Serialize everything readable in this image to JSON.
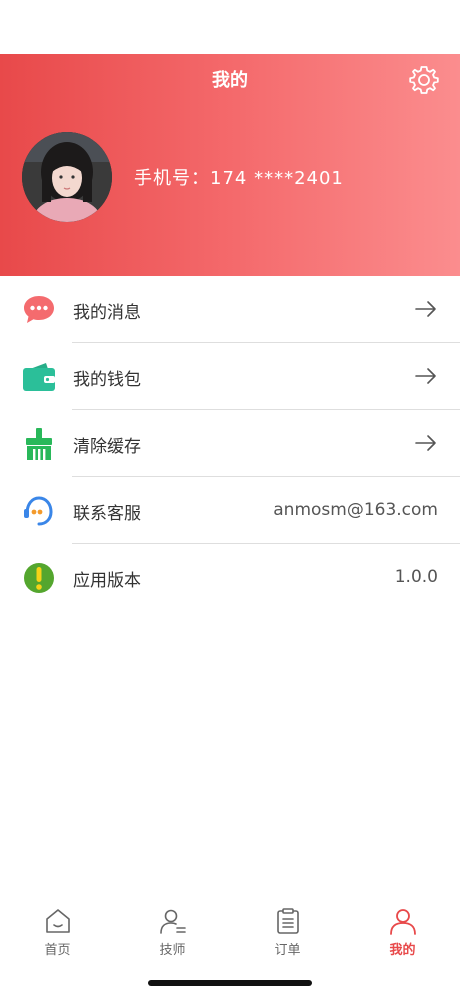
{
  "header": {
    "title": "我的",
    "phone": "手机号：174 ****2401"
  },
  "menu": [
    {
      "label": "我的消息",
      "icon": "message-icon",
      "color": "#f46b6e"
    },
    {
      "label": "我的钱包",
      "icon": "wallet-icon",
      "color": "#2bbf99"
    },
    {
      "label": "清除缓存",
      "icon": "broom-icon",
      "color": "#29b85a"
    },
    {
      "label": "联系客服",
      "icon": "headset-icon",
      "value": "anmosm@163.com",
      "color": "#3a86e8"
    },
    {
      "label": "应用版本",
      "icon": "info-icon",
      "value": "1.0.0",
      "color": "#54a62e"
    }
  ],
  "tabbar": [
    {
      "label": "首页",
      "icon": "home-icon"
    },
    {
      "label": "技师",
      "icon": "technician-icon"
    },
    {
      "label": "订单",
      "icon": "order-icon"
    },
    {
      "label": "我的",
      "icon": "profile-icon",
      "active": true
    }
  ],
  "colors": {
    "accent": "#e8494a",
    "header_gradient_start": "#e8494a",
    "header_gradient_end": "#fb8d8e"
  }
}
